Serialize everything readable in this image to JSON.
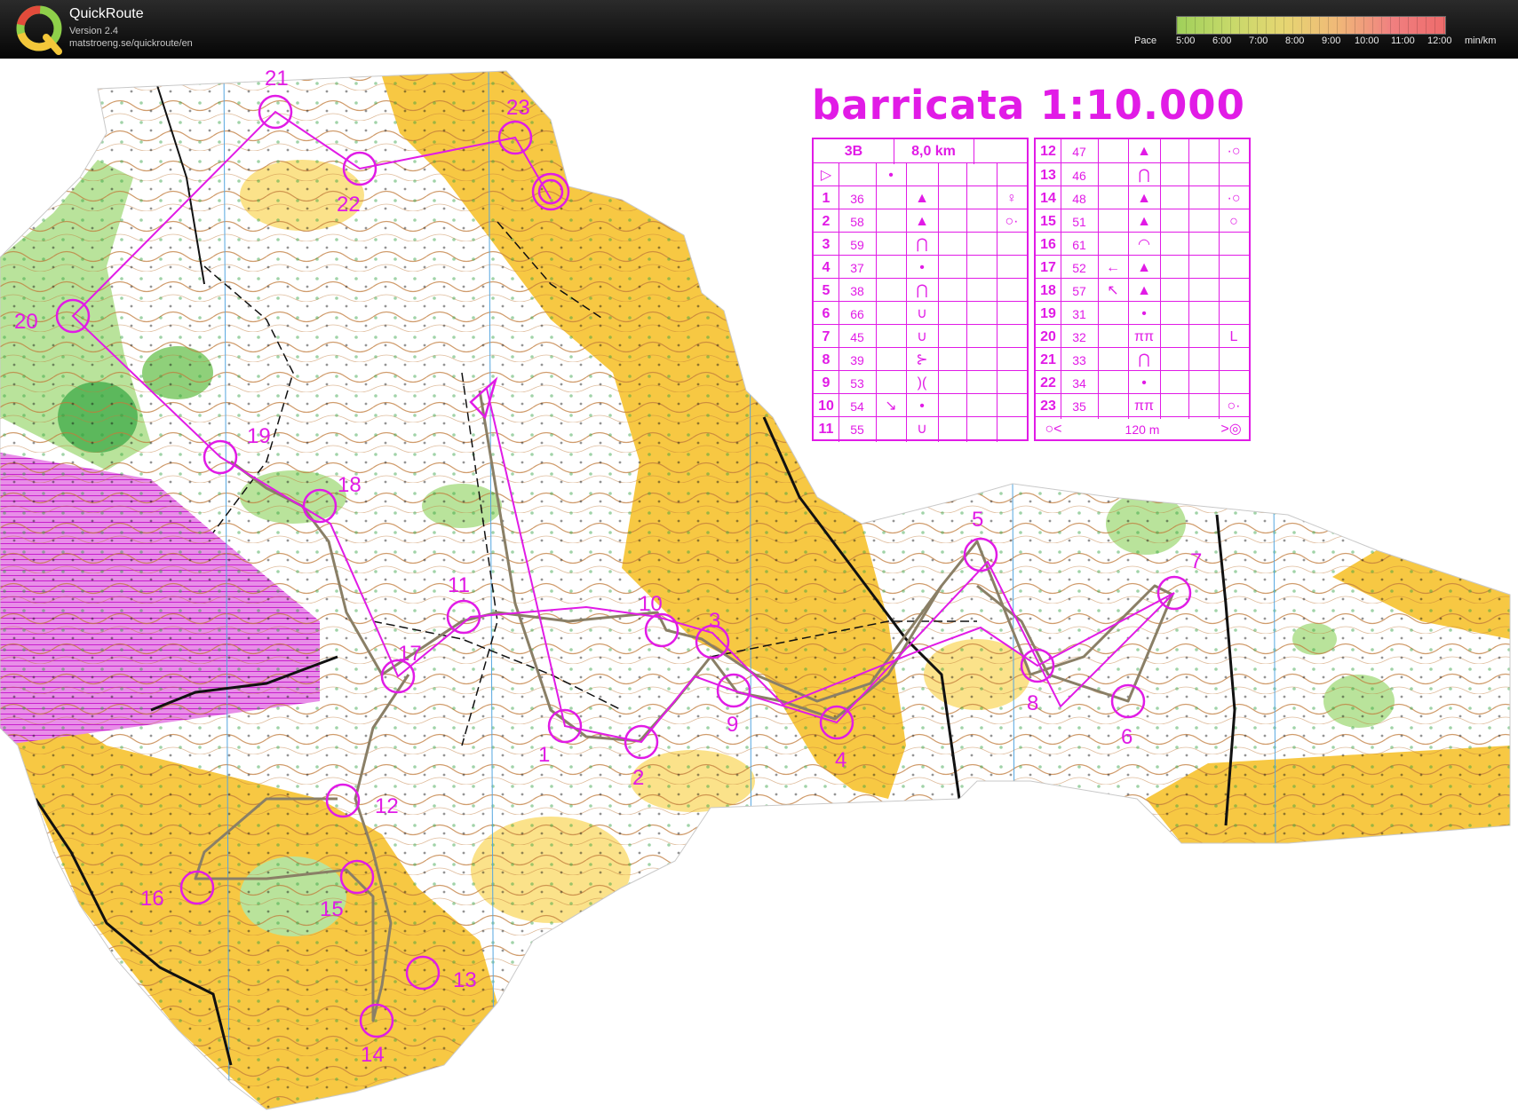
{
  "app": {
    "title": "QuickRoute",
    "version": "Version 2.4",
    "url": "matstroeng.se/quickroute/en"
  },
  "pace_scale": {
    "label": "Pace",
    "unit": "min/km",
    "ticks": [
      "5:00",
      "6:00",
      "7:00",
      "8:00",
      "9:00",
      "10:00",
      "11:00",
      "12:00"
    ],
    "gradient": [
      "#9fd05a",
      "#c7d96a",
      "#e6d672",
      "#f0b878",
      "#f08080",
      "#ee6b6b"
    ]
  },
  "map": {
    "title": "barricata  1:10.000",
    "colors": {
      "open": "#f7c843",
      "rough": "#fbe28a",
      "forest": "#ffffff",
      "green": "#b9e39b",
      "dark_green": "#5cb85c",
      "contour": "#b86a2b",
      "course": "#e11be6",
      "route": "#8a7f66",
      "restricted": "#d33ad6"
    },
    "controls": [
      "1",
      "2",
      "3",
      "4",
      "5",
      "6",
      "7",
      "8",
      "9",
      "10",
      "11",
      "12",
      "13",
      "14",
      "15",
      "16",
      "17",
      "18",
      "19",
      "20",
      "21",
      "22",
      "23"
    ]
  },
  "description": {
    "class": "3B",
    "length": "8,0 km",
    "finish_distance": "120 m",
    "left_rows": [
      {
        "n": "1",
        "code": "36",
        "d": "",
        "sym": "▲",
        "extra": "♀"
      },
      {
        "n": "2",
        "code": "58",
        "d": "",
        "sym": "▲",
        "extra": "○·"
      },
      {
        "n": "3",
        "code": "59",
        "d": "",
        "sym": "⋂",
        "extra": ""
      },
      {
        "n": "4",
        "code": "37",
        "d": "",
        "sym": "•",
        "extra": ""
      },
      {
        "n": "5",
        "code": "38",
        "d": "",
        "sym": "⋂",
        "extra": ""
      },
      {
        "n": "6",
        "code": "66",
        "d": "",
        "sym": "∪",
        "extra": ""
      },
      {
        "n": "7",
        "code": "45",
        "d": "",
        "sym": "∪",
        "extra": ""
      },
      {
        "n": "8",
        "code": "39",
        "d": "",
        "sym": "⊱",
        "extra": ""
      },
      {
        "n": "9",
        "code": "53",
        "d": "",
        "sym": ")(",
        "extra": ""
      },
      {
        "n": "10",
        "code": "54",
        "d": "↘",
        "sym": "•",
        "extra": ""
      },
      {
        "n": "11",
        "code": "55",
        "d": "",
        "sym": "∪",
        "extra": ""
      }
    ],
    "right_rows": [
      {
        "n": "12",
        "code": "47",
        "d": "",
        "sym": "▲",
        "extra": "·○"
      },
      {
        "n": "13",
        "code": "46",
        "d": "",
        "sym": "⋂",
        "extra": ""
      },
      {
        "n": "14",
        "code": "48",
        "d": "",
        "sym": "▲",
        "extra": "·○"
      },
      {
        "n": "15",
        "code": "51",
        "d": "",
        "sym": "▲",
        "extra": "○"
      },
      {
        "n": "16",
        "code": "61",
        "d": "",
        "sym": "◠",
        "extra": ""
      },
      {
        "n": "17",
        "code": "52",
        "d": "←",
        "sym": "▲",
        "extra": ""
      },
      {
        "n": "18",
        "code": "57",
        "d": "↖",
        "sym": "▲",
        "extra": ""
      },
      {
        "n": "19",
        "code": "31",
        "d": "",
        "sym": "•",
        "extra": ""
      },
      {
        "n": "20",
        "code": "32",
        "d": "",
        "sym": "ππ",
        "extra": "L"
      },
      {
        "n": "21",
        "code": "33",
        "d": "",
        "sym": "⋂",
        "extra": ""
      },
      {
        "n": "22",
        "code": "34",
        "d": "",
        "sym": "•",
        "extra": ""
      },
      {
        "n": "23",
        "code": "35",
        "d": "",
        "sym": "ππ",
        "extra": "○·"
      }
    ]
  }
}
